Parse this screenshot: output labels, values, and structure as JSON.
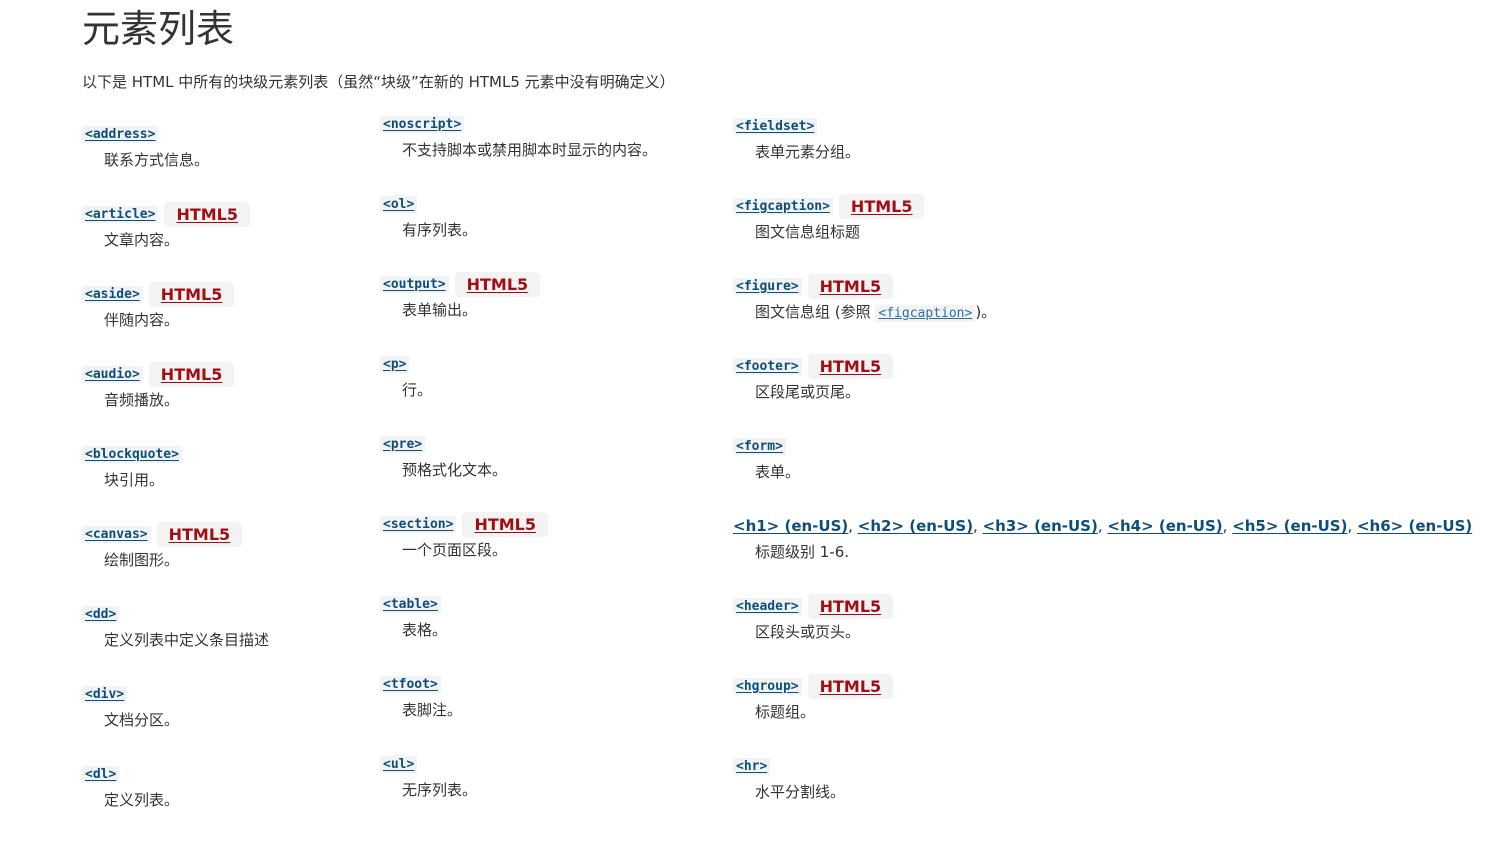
{
  "page": {
    "title": "元素列表",
    "intro": "以下是 HTML 中所有的块级元素列表（虽然“块级”在新的 HTML5 元素中没有明确定义）"
  },
  "columns": [
    [
      {
        "tag": "<address>",
        "badge": "",
        "desc": "联系方式信息。"
      },
      {
        "tag": "<article>",
        "badge": "HTML5",
        "desc": "文章内容。"
      },
      {
        "tag": "<aside>",
        "badge": "HTML5",
        "desc": "伴随内容。"
      },
      {
        "tag": "<audio>",
        "badge": "HTML5",
        "desc": "音频播放。"
      },
      {
        "tag": "<blockquote>",
        "badge": "",
        "desc": "块引用。"
      },
      {
        "tag": "<canvas>",
        "badge": "HTML5",
        "desc": "绘制图形。"
      },
      {
        "tag": "<dd>",
        "badge": "",
        "desc": "定义列表中定义条目描述"
      },
      {
        "tag": "<div>",
        "badge": "",
        "desc": "文档分区。"
      },
      {
        "tag": "<dl>",
        "badge": "",
        "desc": "定义列表。"
      }
    ],
    [
      {
        "tag": "<noscript>",
        "badge": "",
        "desc": "不支持脚本或禁用脚本时显示的内容。"
      },
      {
        "tag": "<ol>",
        "badge": "",
        "desc": "有序列表。"
      },
      {
        "tag": "<output>",
        "badge": "HTML5",
        "desc": "表单输出。"
      },
      {
        "tag": "<p>",
        "badge": "",
        "desc": "行。"
      },
      {
        "tag": "<pre>",
        "badge": "",
        "desc": "预格式化文本。"
      },
      {
        "tag": "<section>",
        "badge": "HTML5",
        "desc": "一个页面区段。"
      },
      {
        "tag": "<table>",
        "badge": "",
        "desc": "表格。"
      },
      {
        "tag": "<tfoot>",
        "badge": "",
        "desc": "表脚注。"
      },
      {
        "tag": "<ul>",
        "badge": "",
        "desc": "无序列表。"
      }
    ],
    [
      {
        "tag": "<fieldset>",
        "badge": "",
        "desc": "表单元素分组。"
      },
      {
        "tag": "<figcaption>",
        "badge": "HTML5",
        "desc": "图文信息组标题"
      },
      {
        "tag": "<figure>",
        "badge": "HTML5",
        "desc_pre": "图文信息组 (参照 ",
        "desc_code": "<figcaption>",
        "desc_post": ")。"
      },
      {
        "tag": "<footer>",
        "badge": "HTML5",
        "desc": "区段尾或页尾。"
      },
      {
        "tag": "<form>",
        "badge": "",
        "desc": "表单。"
      },
      {
        "headings": [
          "<h1> (en-US)",
          "<h2> (en-US)",
          "<h3> (en-US)",
          "<h4> (en-US)",
          "<h5> (en-US)",
          "<h6> (en-US)"
        ],
        "separator": ", ",
        "desc": "标题级别 1-6."
      },
      {
        "tag": "<header>",
        "badge": "HTML5",
        "desc": "区段头或页头。"
      },
      {
        "tag": "<hgroup>",
        "badge": "HTML5",
        "desc": "标题组。"
      },
      {
        "tag": "<hr>",
        "badge": "",
        "desc": "水平分割线。"
      }
    ]
  ]
}
